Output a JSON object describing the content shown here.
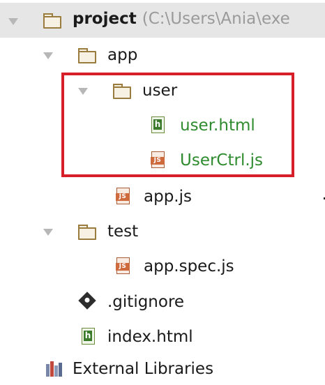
{
  "tree": {
    "root": {
      "name": "project",
      "path": "(C:\\Users\\Ania\\exe"
    },
    "items": [
      {
        "label": "app",
        "kind": "folder"
      },
      {
        "label": "user",
        "kind": "folder"
      },
      {
        "label": "user.html",
        "kind": "html"
      },
      {
        "label": "UserCtrl.js",
        "kind": "js"
      },
      {
        "label": "app.js",
        "kind": "js"
      },
      {
        "label": "test",
        "kind": "folder"
      },
      {
        "label": "app.spec.js",
        "kind": "js"
      },
      {
        "label": ".gitignore",
        "kind": "git"
      },
      {
        "label": "index.html",
        "kind": "html"
      },
      {
        "label": "External Libraries",
        "kind": "libraries"
      }
    ],
    "icon_glyphs": {
      "html": "h",
      "js": "JS"
    }
  },
  "highlight_color": "#d61f29",
  "new_file_color": "#2e8b2e"
}
